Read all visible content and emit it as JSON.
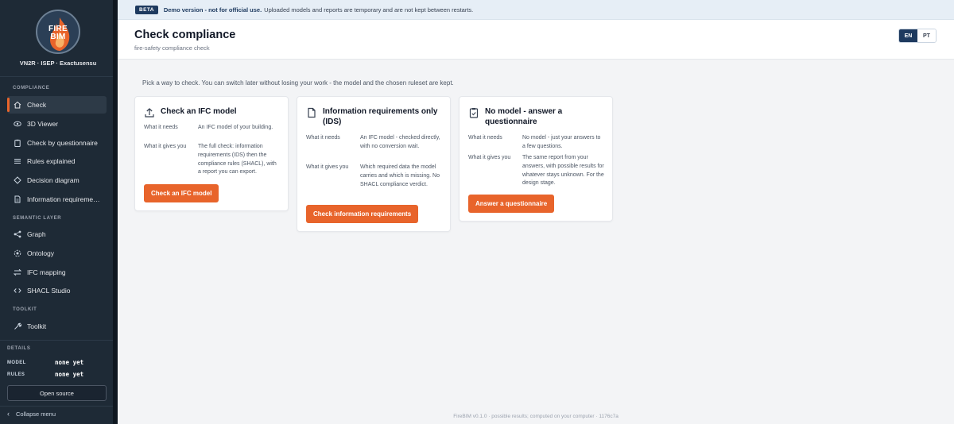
{
  "brand": {
    "logo_text_1": "FIRE",
    "logo_text_2": "BIM",
    "org": "VN2R · ISEP · Exactusensu"
  },
  "sidebar": {
    "sections": {
      "compliance": "COMPLIANCE",
      "semantic": "SEMANTIC LAYER",
      "toolkit": "TOOLKIT",
      "details": "DETAILS"
    },
    "items": [
      {
        "label": "Check",
        "icon": "home-icon",
        "active": true
      },
      {
        "label": "3D Viewer",
        "icon": "eye-icon"
      },
      {
        "label": "Check by questionnaire",
        "icon": "clipboard-icon"
      },
      {
        "label": "Rules explained",
        "icon": "list-icon"
      },
      {
        "label": "Decision diagram",
        "icon": "diagram-icon"
      },
      {
        "label": "Information requireme…",
        "icon": "document-icon"
      },
      {
        "label": "Graph",
        "icon": "graph-icon"
      },
      {
        "label": "Ontology",
        "icon": "ontology-icon"
      },
      {
        "label": "IFC mapping",
        "icon": "mapping-icon"
      },
      {
        "label": "SHACL Studio",
        "icon": "code-icon"
      },
      {
        "label": "Toolkit",
        "icon": "wrench-icon"
      }
    ],
    "details": {
      "model_label": "MODEL",
      "model_value": "none yet",
      "rules_label": "RULES",
      "rules_value": "none yet"
    },
    "open_source": "Open source",
    "collapse": "Collapse menu"
  },
  "banner": {
    "badge": "BETA",
    "strong": "Demo version - not for official use.",
    "text": "Uploaded models and reports are temporary and are not kept between restarts."
  },
  "header": {
    "title": "Check compliance",
    "subtitle": "fire-safety compliance check",
    "lang_en": "EN",
    "lang_pt": "PT"
  },
  "intro": "Pick a way to check. You can switch later without losing your work - the model and the chosen ruleset are kept.",
  "cards": [
    {
      "title": "Check an IFC model",
      "needs_label": "What it needs",
      "needs": "An IFC model of your building.",
      "gives_label": "What it gives you",
      "gives": "The full check: information requirements (IDS) then the compliance rules (SHACL), with a report you can export.",
      "button": "Check an IFC model"
    },
    {
      "title": "Information requirements only (IDS)",
      "needs_label": "What it needs",
      "needs": "An IFC model - checked directly, with no conversion wait.",
      "gives_label": "What it gives you",
      "gives": "Which required data the model carries and which is missing. No SHACL compliance verdict.",
      "button": "Check information requirements"
    },
    {
      "title": "No model - answer a questionnaire",
      "needs_label": "What it needs",
      "needs": "No model - just your answers to a few questions.",
      "gives_label": "What it gives you",
      "gives": "The same report from your answers, with possible results for whatever stays unknown. For the design stage.",
      "button": "Answer a questionnaire"
    }
  ],
  "footer": "FireBIM v0.1.0 · possible results; computed on your computer · 1176c7a",
  "colors": {
    "accent": "#e8642b",
    "sidebar_bg": "#1e2a36",
    "brand_navy": "#1e3a5f"
  }
}
